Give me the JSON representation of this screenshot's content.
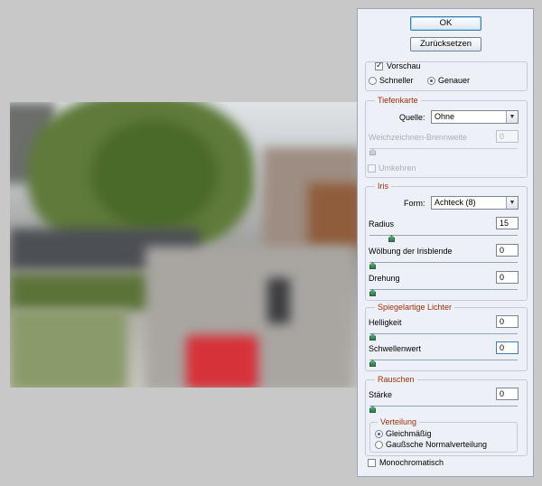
{
  "buttons": {
    "ok": "OK",
    "reset": "Zurücksetzen"
  },
  "preview_group": {
    "preview_label": "Vorschau",
    "preview_checked": true,
    "speed_options": [
      "Schneller",
      "Genauer"
    ],
    "speed_selected": "Genauer"
  },
  "depth_map": {
    "title": "Tiefenkarte",
    "source_label": "Quelle:",
    "source_value": "Ohne",
    "blur_focal_label": "Weichzeichnen-Brennweite",
    "blur_focal_value": "0",
    "invert_label": "Umkehren"
  },
  "iris": {
    "title": "Iris",
    "shape_label": "Form:",
    "shape_value": "Achteck (8)",
    "radius_label": "Radius",
    "radius_value": "15",
    "curvature_label": "Wölbung der Irisblende",
    "curvature_value": "0",
    "rotation_label": "Drehung",
    "rotation_value": "0"
  },
  "specular": {
    "title": "Spiegelartige Lichter",
    "brightness_label": "Helligkeit",
    "brightness_value": "0",
    "threshold_label": "Schwellenwert",
    "threshold_value": "0"
  },
  "noise": {
    "title": "Rauschen",
    "amount_label": "Stärke",
    "amount_value": "0",
    "distribution_title": "Verteilung",
    "distribution_options": [
      "Gleichmäßig",
      "Gaußsche Normalverteilung"
    ],
    "distribution_selected": "Gleichmäßig"
  },
  "monochrome_label": "Monochromatisch",
  "colors": {
    "accent_title": "#a0300a",
    "panel_bg": "#edf0f6",
    "page_bg": "#c8c8c8"
  }
}
